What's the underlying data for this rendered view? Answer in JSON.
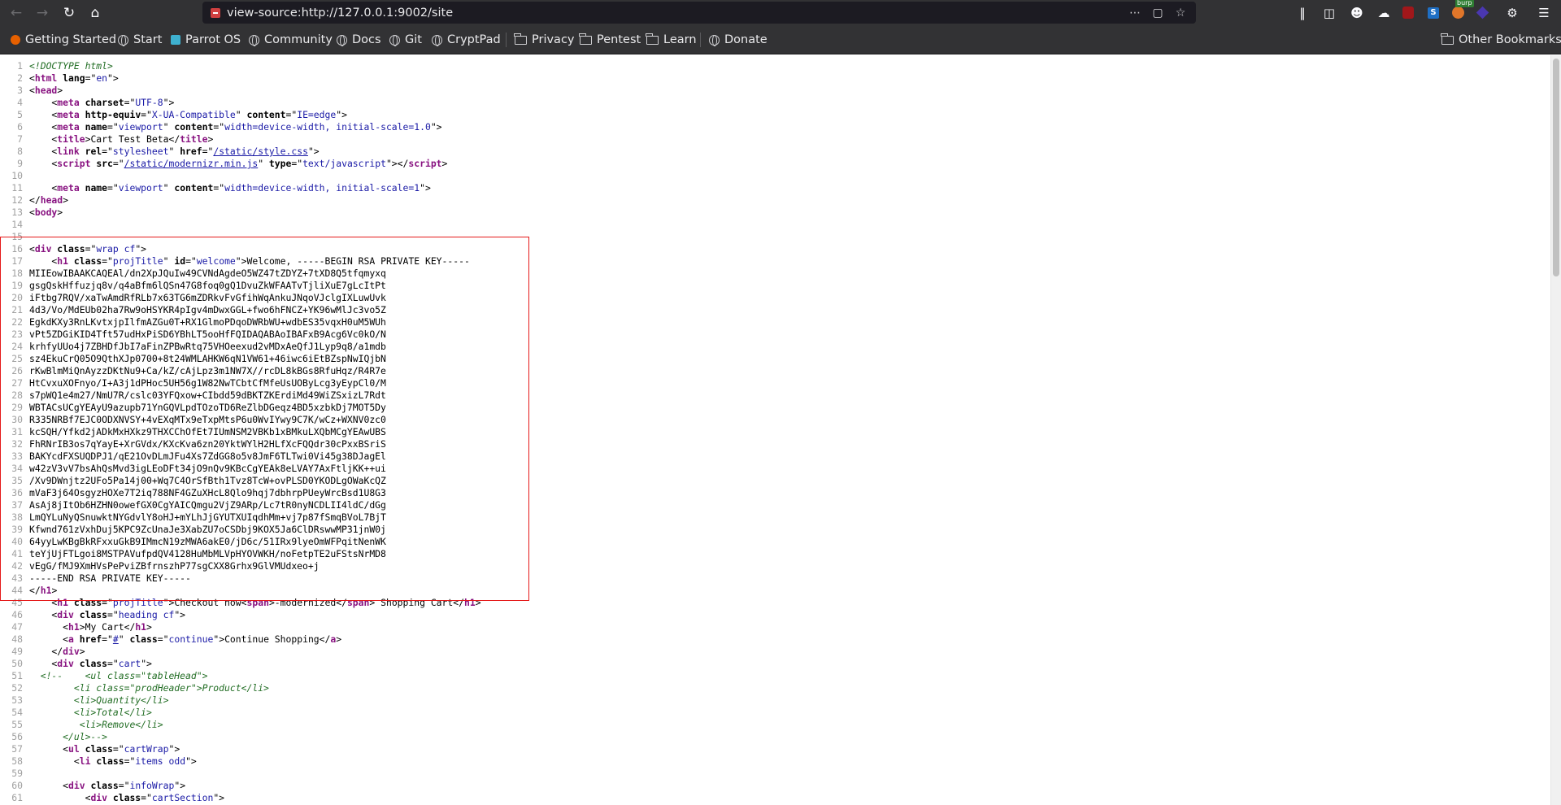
{
  "browser": {
    "url": "view-source:http://127.0.0.1:9002/site",
    "burp_badge": "burp",
    "bookmarks": [
      {
        "label": "Getting Started"
      },
      {
        "label": "Start"
      },
      {
        "label": "Parrot OS"
      },
      {
        "label": "Community"
      },
      {
        "label": "Docs"
      },
      {
        "label": "Git"
      },
      {
        "label": "CryptPad"
      },
      {
        "label": "Privacy"
      },
      {
        "label": "Pentest"
      },
      {
        "label": "Learn"
      },
      {
        "label": "Donate"
      }
    ],
    "other_bookmarks": "Other Bookmarks"
  },
  "source_lines": [
    [
      [
        "d",
        "<!DOCTYPE html>"
      ]
    ],
    [
      [
        "p",
        "<"
      ],
      [
        "t",
        "html"
      ],
      [
        "p",
        " "
      ],
      [
        "a",
        "lang"
      ],
      [
        "p",
        "=\""
      ],
      [
        "v",
        "en"
      ],
      [
        "p",
        "\">"
      ]
    ],
    [
      [
        "p",
        "<"
      ],
      [
        "t",
        "head"
      ],
      [
        "p",
        ">"
      ]
    ],
    [
      [
        "p",
        "    <"
      ],
      [
        "t",
        "meta"
      ],
      [
        "p",
        " "
      ],
      [
        "a",
        "charset"
      ],
      [
        "p",
        "=\""
      ],
      [
        "v",
        "UTF-8"
      ],
      [
        "p",
        "\">"
      ]
    ],
    [
      [
        "p",
        "    <"
      ],
      [
        "t",
        "meta"
      ],
      [
        "p",
        " "
      ],
      [
        "a",
        "http-equiv"
      ],
      [
        "p",
        "=\""
      ],
      [
        "v",
        "X-UA-Compatible"
      ],
      [
        "p",
        "\" "
      ],
      [
        "a",
        "content"
      ],
      [
        "p",
        "=\""
      ],
      [
        "v",
        "IE=edge"
      ],
      [
        "p",
        "\">"
      ]
    ],
    [
      [
        "p",
        "    <"
      ],
      [
        "t",
        "meta"
      ],
      [
        "p",
        " "
      ],
      [
        "a",
        "name"
      ],
      [
        "p",
        "=\""
      ],
      [
        "v",
        "viewport"
      ],
      [
        "p",
        "\" "
      ],
      [
        "a",
        "content"
      ],
      [
        "p",
        "=\""
      ],
      [
        "v",
        "width=device-width, initial-scale=1.0"
      ],
      [
        "p",
        "\">"
      ]
    ],
    [
      [
        "p",
        "    <"
      ],
      [
        "t",
        "title"
      ],
      [
        "p",
        ">Cart Test Beta</"
      ],
      [
        "t",
        "title"
      ],
      [
        "p",
        ">"
      ]
    ],
    [
      [
        "p",
        "    <"
      ],
      [
        "t",
        "link"
      ],
      [
        "p",
        " "
      ],
      [
        "a",
        "rel"
      ],
      [
        "p",
        "=\""
      ],
      [
        "v",
        "stylesheet"
      ],
      [
        "p",
        "\" "
      ],
      [
        "a",
        "href"
      ],
      [
        "p",
        "=\""
      ],
      [
        "l",
        "/static/style.css"
      ],
      [
        "p",
        "\">"
      ]
    ],
    [
      [
        "p",
        "    <"
      ],
      [
        "t",
        "script"
      ],
      [
        "p",
        " "
      ],
      [
        "a",
        "src"
      ],
      [
        "p",
        "=\""
      ],
      [
        "l",
        "/static/modernizr.min.js"
      ],
      [
        "p",
        "\" "
      ],
      [
        "a",
        "type"
      ],
      [
        "p",
        "=\""
      ],
      [
        "v",
        "text/javascript"
      ],
      [
        "p",
        "\"></"
      ],
      [
        "t",
        "script"
      ],
      [
        "p",
        ">"
      ]
    ],
    [],
    [
      [
        "p",
        "    <"
      ],
      [
        "t",
        "meta"
      ],
      [
        "p",
        " "
      ],
      [
        "a",
        "name"
      ],
      [
        "p",
        "=\""
      ],
      [
        "v",
        "viewport"
      ],
      [
        "p",
        "\" "
      ],
      [
        "a",
        "content"
      ],
      [
        "p",
        "=\""
      ],
      [
        "v",
        "width=device-width, initial-scale=1"
      ],
      [
        "p",
        "\">"
      ]
    ],
    [
      [
        "p",
        "</"
      ],
      [
        "t",
        "head"
      ],
      [
        "p",
        ">"
      ]
    ],
    [
      [
        "p",
        "<"
      ],
      [
        "t",
        "body"
      ],
      [
        "p",
        ">"
      ]
    ],
    [],
    [],
    [
      [
        "p",
        "<"
      ],
      [
        "t",
        "div"
      ],
      [
        "p",
        " "
      ],
      [
        "a",
        "class"
      ],
      [
        "p",
        "=\""
      ],
      [
        "v",
        "wrap cf"
      ],
      [
        "p",
        "\">"
      ]
    ],
    [
      [
        "p",
        "    <"
      ],
      [
        "t",
        "h1"
      ],
      [
        "p",
        " "
      ],
      [
        "a",
        "class"
      ],
      [
        "p",
        "=\""
      ],
      [
        "v",
        "projTitle"
      ],
      [
        "p",
        "\" "
      ],
      [
        "a",
        "id"
      ],
      [
        "p",
        "=\""
      ],
      [
        "v",
        "welcome"
      ],
      [
        "p",
        "\">Welcome, -----BEGIN RSA PRIVATE KEY-----"
      ]
    ],
    [
      [
        "p",
        "MIIEowIBAAKCAQEAl/dn2XpJQuIw49CVNdAgdeO5WZ47tZDYZ+7tXD8Q5tfqmyxq"
      ]
    ],
    [
      [
        "p",
        "gsgQskHffuzjq8v/q4aBfm6lQSn47G8foq0gQ1DvuZkWFAATvTjliXuE7gLcItPt"
      ]
    ],
    [
      [
        "p",
        "iFtbg7RQV/xaTwAmdRfRLb7x63TG6mZDRkvFvGfihWqAnkuJNqoVJclgIXLuwUvk"
      ]
    ],
    [
      [
        "p",
        "4d3/Vo/MdEUb02ha7Rw9oHSYKR4pIgv4mDwxGGL+fwo6hFNCZ+YK96wMlJc3vo5Z"
      ]
    ],
    [
      [
        "p",
        "EgkdKXy3RnLKvtxjpIlfmAZGu0T+RX1GlmoPDqoDWRbWU+wdbES35vqxH0uM5WUh"
      ]
    ],
    [
      [
        "p",
        "vPt5ZDGiKID4Tft57udHxPiSD6YBhLT5ooHfFQIDAQABAoIBAFxB9Acg6Vc0kO/N"
      ]
    ],
    [
      [
        "p",
        "krhfyUUo4j7ZBHDfJbI7aFinZPBwRtq75VHOeexud2vMDxAeQfJ1Lyp9q8/a1mdb"
      ]
    ],
    [
      [
        "p",
        "sz4EkuCrQ05O9QthXJp0700+8t24WMLAHKW6qN1VW61+46iwc6iEtBZspNwIQjbN"
      ]
    ],
    [
      [
        "p",
        "rKwBlmMiQnAyzzDKtNu9+Ca/kZ/cAjLpz3m1NW7X//rcDL8kBGs8RfuHqz/R4R7e"
      ]
    ],
    [
      [
        "p",
        "HtCvxuXOFnyo/I+A3j1dPHoc5UH56g1W82NwTCbtCfMfeUsUOByLcg3yEypCl0/M"
      ]
    ],
    [
      [
        "p",
        "s7pWQ1e4m27/NmU7R/cslc03YFQxow+CIbdd59dBKTZKErdiMd49WiZSxizL7Rdt"
      ]
    ],
    [
      [
        "p",
        "WBTACsUCgYEAyU9azupb71YnGQVLpdTOzoTD6ReZlbDGeqz4BD5xzbkDj7MOT5Dy"
      ]
    ],
    [
      [
        "p",
        "R335NRBf7EJC0ODXNVSY+4vEXqMTx9eTxpMtsP6u0WvIYwy9C7K/wCz+WXNV0zc0"
      ]
    ],
    [
      [
        "p",
        "kcSQH/Yfkd2jADkMxHXkz9THXCChOfEt7IUmNSM2VBKb1xBMkuLXQbMCgYEAwUBS"
      ]
    ],
    [
      [
        "p",
        "FhRNrIB3os7qYayE+XrGVdx/KXcKva6zn20YktWYlH2HLfXcFQQdr30cPxxBSriS"
      ]
    ],
    [
      [
        "p",
        "BAKYcdFXSUQDPJ1/qE21OvDLmJFu4Xs7ZdGG8o5v8JmF6TLTwi0Vi45g38DJagEl"
      ]
    ],
    [
      [
        "p",
        "w42zV3vV7bsAhQsMvd3igLEoDFt34jO9nQv9KBcCgYEAk8eLVAY7AxFtljKK++ui"
      ]
    ],
    [
      [
        "p",
        "/Xv9DWnjtz2UFo5Pa14j00+Wq7C4OrSfBth1Tvz8TcW+ovPLSD0YKODLgOWaKcQZ"
      ]
    ],
    [
      [
        "p",
        "mVaF3j64OsgyzHOXe7T2iq788NF4GZuXHcL8Qlo9hqj7dbhrpPUeyWrcBsd1U8G3"
      ]
    ],
    [
      [
        "p",
        "AsAj8jItOb6HZHN0owefGX0CgYAICQmgu2VjZ9ARp/Lc7tR0nyNCDLII4ldC/dGg"
      ]
    ],
    [
      [
        "p",
        "LmQYLuNyQSnuwktNYGdvlY8oHJ+mYLhJjGYUTXUIqdhMm+vj7p87fSmqBVoL7BjT"
      ]
    ],
    [
      [
        "p",
        "Kfwnd761zVxhDuj5KPC9ZcUnaJe3XabZU7oCSDbj9KOX5Ja6ClDRswwMP31jnW0j"
      ]
    ],
    [
      [
        "p",
        "64yyLwKBgBkRFxxuGkB9IMmcN19zMWA6akE0/jD6c/51IRx9lyeOmWFPqitNenWK"
      ]
    ],
    [
      [
        "p",
        "teYjUjFTLgoi8MSTPAVufpdQV4128HuMbMLVpHYOVWKH/noFetpTE2uFStsNrMD8"
      ]
    ],
    [
      [
        "p",
        "vEgG/fMJ9XmHVsPePviZBfrnszhP77sgCXX8Grhx9GlVMUdxeo+j"
      ]
    ],
    [
      [
        "p",
        "-----END RSA PRIVATE KEY-----"
      ]
    ],
    [
      [
        "p",
        "</"
      ],
      [
        "t",
        "h1"
      ],
      [
        "p",
        ">"
      ]
    ],
    [
      [
        "p",
        "    <"
      ],
      [
        "t",
        "h1"
      ],
      [
        "p",
        " "
      ],
      [
        "a",
        "class"
      ],
      [
        "p",
        "=\""
      ],
      [
        "v",
        "projTitle"
      ],
      [
        "p",
        "\">Checkout now<"
      ],
      [
        "t",
        "span"
      ],
      [
        "p",
        ">-modernized</"
      ],
      [
        "t",
        "span"
      ],
      [
        "p",
        "> Shopping Cart</"
      ],
      [
        "t",
        "h1"
      ],
      [
        "p",
        ">"
      ]
    ],
    [
      [
        "p",
        "    <"
      ],
      [
        "t",
        "div"
      ],
      [
        "p",
        " "
      ],
      [
        "a",
        "class"
      ],
      [
        "p",
        "=\""
      ],
      [
        "v",
        "heading cf"
      ],
      [
        "p",
        "\">"
      ]
    ],
    [
      [
        "p",
        "      <"
      ],
      [
        "t",
        "h1"
      ],
      [
        "p",
        ">My Cart</"
      ],
      [
        "t",
        "h1"
      ],
      [
        "p",
        ">"
      ]
    ],
    [
      [
        "p",
        "      <"
      ],
      [
        "t",
        "a"
      ],
      [
        "p",
        " "
      ],
      [
        "a",
        "href"
      ],
      [
        "p",
        "=\""
      ],
      [
        "l",
        "#"
      ],
      [
        "p",
        "\" "
      ],
      [
        "a",
        "class"
      ],
      [
        "p",
        "=\""
      ],
      [
        "v",
        "continue"
      ],
      [
        "p",
        "\">Continue Shopping</"
      ],
      [
        "t",
        "a"
      ],
      [
        "p",
        ">"
      ]
    ],
    [
      [
        "p",
        "    </"
      ],
      [
        "t",
        "div"
      ],
      [
        "p",
        ">"
      ]
    ],
    [
      [
        "p",
        "    <"
      ],
      [
        "t",
        "div"
      ],
      [
        "p",
        " "
      ],
      [
        "a",
        "class"
      ],
      [
        "p",
        "=\""
      ],
      [
        "v",
        "cart"
      ],
      [
        "p",
        "\">"
      ]
    ],
    [
      [
        "c",
        "  <!--    <ul class=\"tableHead\">"
      ]
    ],
    [
      [
        "c",
        "        <li class=\"prodHeader\">Product</li>"
      ]
    ],
    [
      [
        "c",
        "        <li>Quantity</li>"
      ]
    ],
    [
      [
        "c",
        "        <li>Total</li>"
      ]
    ],
    [
      [
        "c",
        "         <li>Remove</li>"
      ]
    ],
    [
      [
        "c",
        "      </ul>-->"
      ]
    ],
    [
      [
        "p",
        "      <"
      ],
      [
        "t",
        "ul"
      ],
      [
        "p",
        " "
      ],
      [
        "a",
        "class"
      ],
      [
        "p",
        "=\""
      ],
      [
        "v",
        "cartWrap"
      ],
      [
        "p",
        "\">"
      ]
    ],
    [
      [
        "p",
        "        <"
      ],
      [
        "t",
        "li"
      ],
      [
        "p",
        " "
      ],
      [
        "a",
        "class"
      ],
      [
        "p",
        "=\""
      ],
      [
        "v",
        "items odd"
      ],
      [
        "p",
        "\">"
      ]
    ],
    [],
    [
      [
        "p",
        "      <"
      ],
      [
        "t",
        "div"
      ],
      [
        "p",
        " "
      ],
      [
        "a",
        "class"
      ],
      [
        "p",
        "=\""
      ],
      [
        "v",
        "infoWrap"
      ],
      [
        "p",
        "\">"
      ]
    ],
    [
      [
        "p",
        "          <"
      ],
      [
        "t",
        "div"
      ],
      [
        "p",
        " "
      ],
      [
        "a",
        "class"
      ],
      [
        "p",
        "=\""
      ],
      [
        "v",
        "cartSection"
      ],
      [
        "p",
        "\">"
      ]
    ]
  ]
}
